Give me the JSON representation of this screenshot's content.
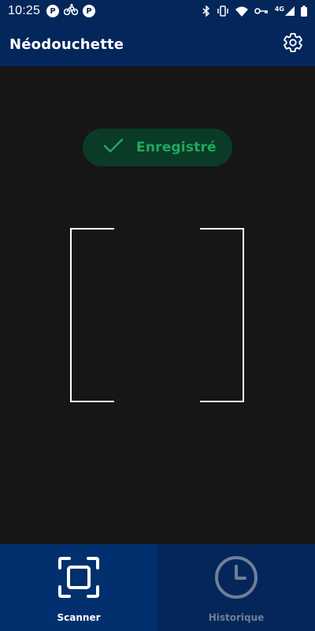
{
  "status_bar": {
    "time": "10:25",
    "left_icons": [
      "P",
      "bike",
      "P"
    ],
    "right_icons": [
      "bluetooth-icon",
      "vibrate-icon",
      "wifi-icon",
      "key-icon",
      "network-4g-icon",
      "battery-icon"
    ],
    "network_label": "4G"
  },
  "app_bar": {
    "title": "Néodouchette",
    "settings_icon": "gear-icon"
  },
  "toast": {
    "label": "Enregistré",
    "icon": "check-icon"
  },
  "bottom_nav": {
    "items": [
      {
        "label": "Scanner",
        "icon": "scan-icon",
        "active": true
      },
      {
        "label": "Historique",
        "icon": "clock-icon",
        "active": false
      }
    ]
  },
  "colors": {
    "primary": "#03275b",
    "background": "#161616",
    "success": "#1ea95f",
    "inactive": "#6f7f98"
  }
}
